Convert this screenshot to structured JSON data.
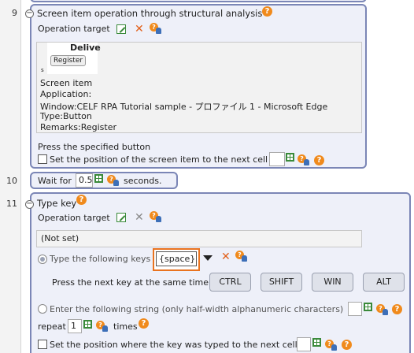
{
  "rows": [
    {
      "number": "9",
      "title": "Screen item operation through structural analysis",
      "operation_target_label": "Operation target",
      "preview": {
        "thumb_heading": "Delive",
        "thumb_button": "Register",
        "thumb_mark": "s",
        "lines": [
          "Screen item",
          "Application:",
          "Window:CELF RPA Tutorial sample - プロファイル 1 - Microsoft Edge",
          "Type:Button",
          "Remarks:Register"
        ]
      },
      "action_text": "Press the specified button",
      "set_position_label": "Set the position of the screen item to the next cell",
      "set_position_value": ""
    },
    {
      "number": "10",
      "wait_label": "Wait for",
      "wait_value": "0.5",
      "wait_unit": "seconds."
    },
    {
      "number": "11",
      "title": "Type key",
      "operation_target_label": "Operation target",
      "target_value": "(Not set)",
      "type_keys_label": "Type the following keys",
      "key_value": "{space}",
      "press_next_label": "Press the next key at the same time",
      "modifier_keys": [
        "CTRL",
        "SHIFT",
        "WIN",
        "ALT"
      ],
      "enter_string_label": "Enter the following string (only half-width alphanumeric characters)",
      "enter_string_value": "",
      "repeat_label": "repeat",
      "repeat_value": "1",
      "times_label": "times",
      "set_position_label": "Set the position where the key was typed to the next cell",
      "set_position_value": ""
    }
  ],
  "icons": {
    "help": "help-icon",
    "edit": "edit-target-icon",
    "clear": "clear-icon",
    "user_help": "user-help-icon",
    "cell_grid": "cell-grid-icon",
    "collapse": "collapse-icon",
    "dropdown": "dropdown-arrow-icon"
  },
  "colors": {
    "card_background": "#eef0f9",
    "card_border": "#7b86b6",
    "help_orange": "#f08a1c",
    "clear_orange": "#e2601a",
    "focus_orange": "#e9731f",
    "grid_green": "#3a8a3a"
  }
}
